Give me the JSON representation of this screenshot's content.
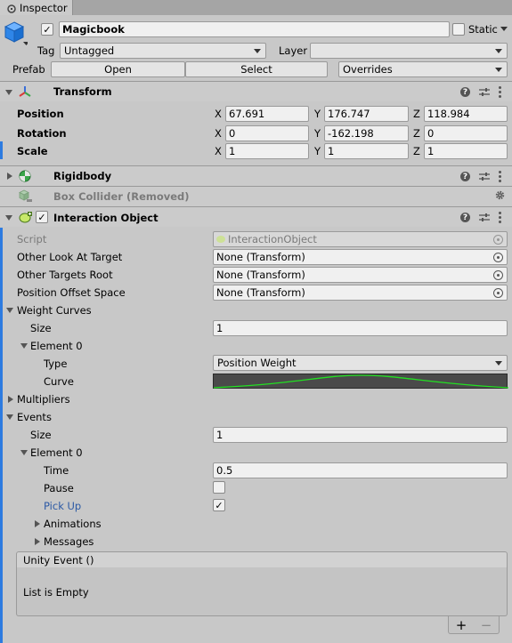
{
  "window": {
    "tab_title": "Inspector"
  },
  "object": {
    "active": true,
    "name": "Magicbook",
    "static_label": "Static",
    "tag_label": "Tag",
    "tag_value": "Untagged",
    "layer_label": "Layer",
    "layer_value": "",
    "prefab_label": "Prefab",
    "open_label": "Open",
    "select_label": "Select",
    "overrides_label": "Overrides"
  },
  "transform": {
    "title": "Transform",
    "rows": [
      {
        "label": "Position",
        "x": "67.691",
        "y": "176.747",
        "z": "118.984"
      },
      {
        "label": "Rotation",
        "x": "0",
        "y": "-162.198",
        "z": "0"
      },
      {
        "label": "Scale",
        "x": "1",
        "y": "1",
        "z": "1"
      }
    ],
    "axis": {
      "x": "X",
      "y": "Y",
      "z": "Z"
    }
  },
  "rigidbody": {
    "title": "Rigidbody"
  },
  "box_collider": {
    "title": "Box Collider (Removed)"
  },
  "interaction": {
    "title": "Interaction Object",
    "script_label": "Script",
    "script_value": "InteractionObject",
    "other_look_label": "Other Look At Target",
    "other_look_value": "None (Transform)",
    "other_targets_label": "Other Targets Root",
    "other_targets_value": "None (Transform)",
    "pos_offset_label": "Position Offset Space",
    "pos_offset_value": "None (Transform)",
    "weight_curves_label": "Weight Curves",
    "wc_size_label": "Size",
    "wc_size_value": "1",
    "wc_element_label": "Element 0",
    "type_label": "Type",
    "type_value": "Position Weight",
    "curve_label": "Curve",
    "multipliers_label": "Multipliers",
    "events_label": "Events",
    "ev_size_label": "Size",
    "ev_size_value": "1",
    "ev_element_label": "Element 0",
    "time_label": "Time",
    "time_value": "0.5",
    "pause_label": "Pause",
    "pause_checked": false,
    "pickup_label": "Pick Up",
    "pickup_checked": true,
    "animations_label": "Animations",
    "messages_label": "Messages",
    "unity_event_header": "Unity Event ()",
    "list_empty": "List is Empty",
    "plus": "+",
    "minus": "−"
  },
  "colors": {
    "accent": "#2d5aa5",
    "curve": "#22e022",
    "curve_bg": "#4a4a4a"
  },
  "icons": [
    "cube-icon",
    "transform-icon",
    "rigidbody-icon",
    "box-collider-icon",
    "script-component-icon",
    "help-icon",
    "preset-icon",
    "kebab-icon",
    "gear-icon",
    "object-picker-icon"
  ]
}
